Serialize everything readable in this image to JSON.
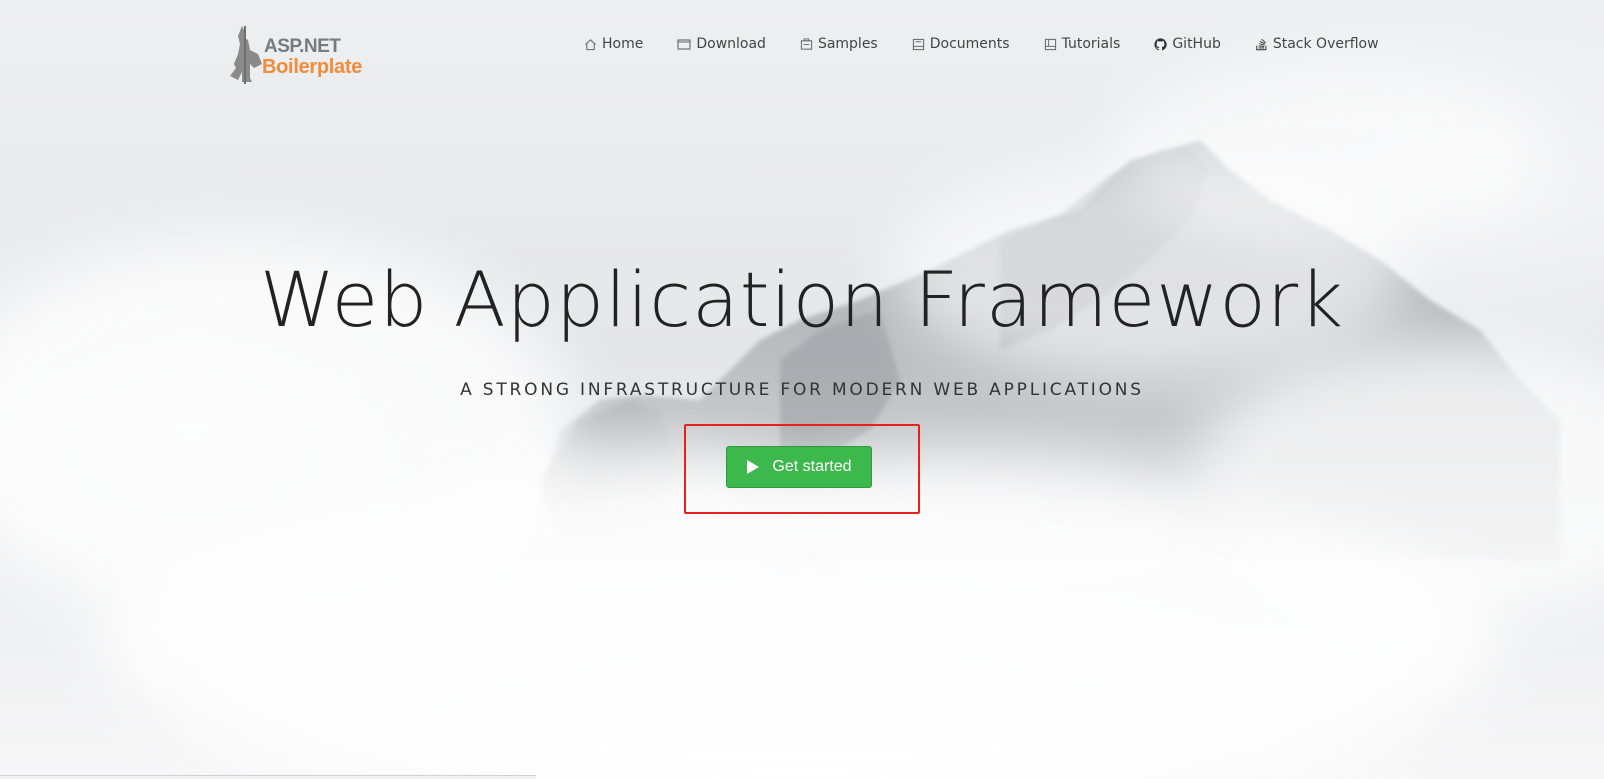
{
  "brand": {
    "line1": "ASP.NET",
    "line2": "Boilerplate",
    "accent_color": "#f08d3c",
    "gray_color": "#7a7a7a"
  },
  "nav": {
    "items": [
      {
        "label": "Home",
        "icon": "home-icon"
      },
      {
        "label": "Download",
        "icon": "download-icon"
      },
      {
        "label": "Samples",
        "icon": "samples-icon"
      },
      {
        "label": "Documents",
        "icon": "documents-icon"
      },
      {
        "label": "Tutorials",
        "icon": "tutorials-icon"
      },
      {
        "label": "GitHub",
        "icon": "github-icon"
      },
      {
        "label": "Stack Overflow",
        "icon": "stack-overflow-icon"
      }
    ]
  },
  "hero": {
    "title": "Web Application Framework",
    "subtitle": "A STRONG INFRASTRUCTURE FOR MODERN WEB APPLICATIONS",
    "cta_label": "Get started",
    "cta_icon": "play-icon",
    "cta_color": "#3cb84c",
    "highlight_color": "#e8211d"
  }
}
